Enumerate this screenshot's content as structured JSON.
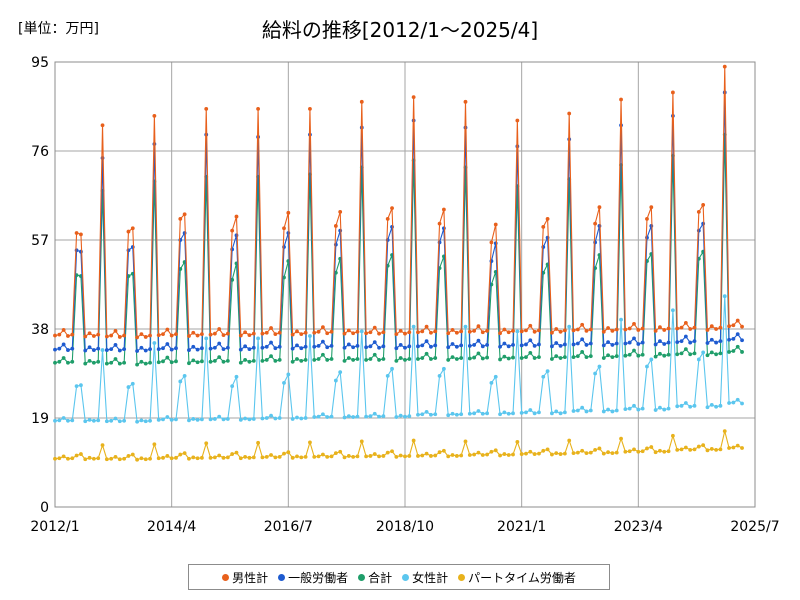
{
  "chart_data": {
    "type": "line",
    "title": "給料の推移[2012/1～2025/4]",
    "unit_label": "[単位：万円]",
    "xlabel": "",
    "ylabel": "",
    "x_start": "2012-01",
    "x_end": "2025-07",
    "x_ticks": [
      "2012/1",
      "2014/4",
      "2016/7",
      "2018/10",
      "2021/1",
      "2023/4",
      "2025/7"
    ],
    "y_ticks": [
      "0",
      "19",
      "38",
      "57",
      "76",
      "95"
    ],
    "ylim": [
      0,
      95
    ],
    "grid": true,
    "legend_position": "bottom",
    "colors": {
      "male": "#e8601c",
      "general": "#1e5bd0",
      "total": "#1f9e6a",
      "female": "#5bc6ee",
      "parttime": "#e8b21c"
    },
    "series": [
      {
        "key": "male",
        "name": "男性計",
        "color": "#e8601c",
        "base": [
          36.8,
          36.6,
          36.9,
          37.0,
          37.2,
          37.4,
          37.3,
          37.5,
          37.6,
          37.7,
          37.9,
          38.1,
          38.3,
          38.8
        ],
        "june": [
          58.5,
          58.8,
          61.5,
          59.0,
          59.5,
          60.0,
          61.5,
          60.5,
          56.5,
          59.8,
          60.5,
          61.5,
          63.0,
          65.5
        ],
        "july": [
          58.2,
          59.5,
          62.5,
          62.0,
          62.8,
          63.0,
          63.8,
          63.5,
          60.3,
          61.5,
          64.0,
          64.0,
          64.5,
          67.5
        ],
        "dec": [
          81.5,
          83.5,
          85.0,
          85.0,
          85.0,
          86.5,
          87.5,
          86.5,
          82.5,
          84.0,
          87.0,
          88.5,
          94.0
        ]
      },
      {
        "key": "general",
        "name": "一般労働者",
        "color": "#1e5bd0",
        "base": [
          33.8,
          33.7,
          33.9,
          34.0,
          34.2,
          34.4,
          34.3,
          34.5,
          34.6,
          34.7,
          34.9,
          35.1,
          35.4,
          35.9
        ],
        "june": [
          54.8,
          54.8,
          57.0,
          55.0,
          55.5,
          56.0,
          57.0,
          56.5,
          52.5,
          55.5,
          56.5,
          57.5,
          59.0,
          61.5
        ],
        "july": [
          54.5,
          55.5,
          58.5,
          58.0,
          58.5,
          59.0,
          59.8,
          59.5,
          56.3,
          57.5,
          60.0,
          60.0,
          60.5,
          63.5
        ],
        "dec": [
          74.5,
          77.5,
          79.5,
          79.0,
          79.5,
          81.0,
          82.5,
          81.0,
          77.0,
          78.5,
          81.5,
          83.5,
          88.5
        ]
      },
      {
        "key": "total",
        "name": "合計",
        "color": "#1f9e6a",
        "base": [
          31.0,
          30.8,
          31.1,
          31.2,
          31.4,
          31.6,
          31.6,
          31.8,
          31.9,
          32.0,
          32.2,
          32.5,
          32.8,
          33.3
        ],
        "june": [
          49.5,
          49.3,
          50.8,
          48.5,
          49.0,
          50.0,
          51.5,
          51.0,
          47.5,
          50.0,
          51.0,
          52.5,
          53.0,
          56.0
        ],
        "july": [
          49.3,
          49.8,
          52.3,
          52.0,
          52.5,
          53.0,
          53.8,
          53.5,
          50.2,
          51.8,
          53.8,
          54.0,
          54.5,
          57.5
        ],
        "dec": [
          67.5,
          69.5,
          70.5,
          70.5,
          71.0,
          72.5,
          74.0,
          72.5,
          68.5,
          70.0,
          73.0,
          75.0,
          79.5
        ]
      },
      {
        "key": "female",
        "name": "女性計",
        "color": "#5bc6ee",
        "base": [
          18.5,
          18.4,
          18.7,
          18.8,
          19.0,
          19.3,
          19.4,
          19.8,
          20.0,
          20.2,
          20.6,
          21.0,
          21.6,
          22.3
        ],
        "june": [
          25.8,
          25.6,
          26.8,
          25.8,
          26.5,
          27.0,
          28.0,
          28.0,
          26.5,
          27.8,
          28.5,
          30.0,
          31.5,
          33.5
        ],
        "july": [
          26.0,
          26.3,
          28.0,
          27.8,
          28.3,
          28.8,
          29.5,
          29.5,
          27.8,
          29.0,
          30.0,
          31.5,
          33.0,
          35.0
        ],
        "dec": [
          33.5,
          35.0,
          36.0,
          36.0,
          36.5,
          37.5,
          38.5,
          38.5,
          37.5,
          38.5,
          40.0,
          42.0,
          45.0
        ]
      },
      {
        "key": "parttime",
        "name": "パートタイム労働者",
        "color": "#e8b21c",
        "base": [
          10.4,
          10.3,
          10.5,
          10.6,
          10.7,
          10.8,
          10.9,
          11.0,
          11.2,
          11.4,
          11.6,
          11.9,
          12.3,
          12.7
        ],
        "june": [
          11.0,
          10.9,
          11.2,
          11.3,
          11.4,
          11.5,
          11.6,
          11.7,
          11.8,
          12.0,
          12.2,
          12.5,
          12.9,
          13.3
        ],
        "july": [
          11.3,
          11.2,
          11.5,
          11.6,
          11.7,
          11.8,
          11.9,
          12.0,
          12.1,
          12.3,
          12.5,
          12.8,
          13.2,
          13.6
        ],
        "dec": [
          13.2,
          13.4,
          13.6,
          13.7,
          13.8,
          14.0,
          14.2,
          14.0,
          13.9,
          14.2,
          14.6,
          15.2,
          16.2
        ]
      }
    ]
  }
}
